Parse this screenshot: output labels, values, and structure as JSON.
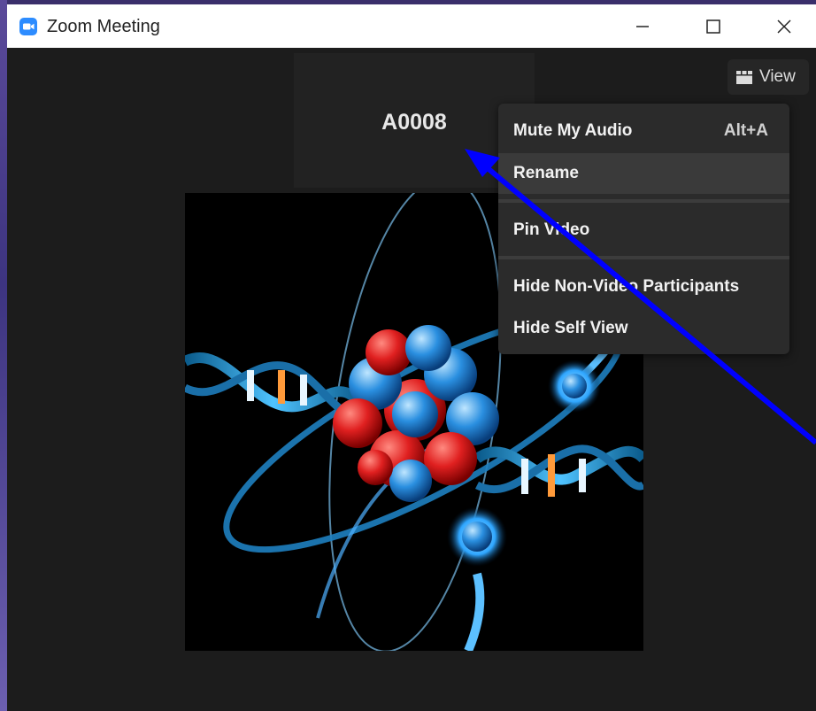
{
  "window": {
    "title": "Zoom Meeting"
  },
  "participant": {
    "name": "A0008"
  },
  "toolbar": {
    "view_label": "View"
  },
  "context_menu": {
    "items": [
      {
        "label": "Mute My Audio",
        "shortcut": "Alt+A"
      },
      {
        "label": "Rename"
      },
      {
        "label": "Pin Video"
      },
      {
        "label": "Hide Non-Video Participants"
      },
      {
        "label": "Hide Self View"
      }
    ],
    "highlighted": "Rename"
  },
  "colors": {
    "zoom_blue": "#2d8cff",
    "annotation_arrow": "#0000ff",
    "background": "#1c1c1c"
  },
  "icons": {
    "app": "zoom-camera-icon",
    "minimize": "minimize-icon",
    "maximize": "maximize-icon",
    "close": "close-icon",
    "view": "grid-view-icon"
  }
}
